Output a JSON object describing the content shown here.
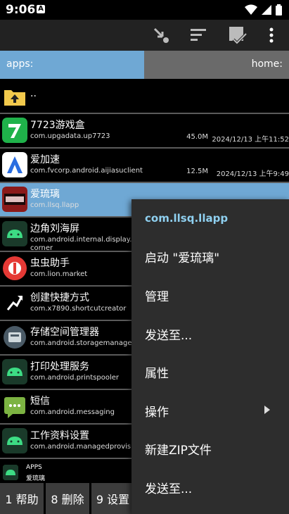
{
  "status": {
    "time": "9:06",
    "notification": "A"
  },
  "path": {
    "left": "apps:",
    "right": "home:"
  },
  "parent_label": "..",
  "apps": [
    {
      "name": "7723游戏盒",
      "package": "com.upgadata.up7723",
      "size": "45.0M",
      "date": "2024/12/13 上午11:52",
      "icon": "7723-app-icon",
      "color": "#1fb24a"
    },
    {
      "name": "爱加速",
      "package": "com.fvcorp.android.aijiasuclient",
      "size": "12.5M",
      "date": "2024/12/13 上午9:49",
      "icon": "aijiasu-app-icon",
      "color": "#ffffff"
    },
    {
      "name": "爱琉璃",
      "package": "com.llsq.llapp",
      "size": "",
      "date": "",
      "icon": "ailiuli-app-icon",
      "color": "#8b1a1a",
      "selected": true
    },
    {
      "name": "边角刘海屏",
      "package": "com.android.internal.display.cutout.emulation.corner",
      "package_lines": [
        "com.android.internal.display.cut",
        "corner"
      ],
      "size": "",
      "date": "",
      "icon": "android-app-icon",
      "color": "#3ddc84"
    },
    {
      "name": "虫虫助手",
      "package": "com.lion.market",
      "size": "",
      "date": "",
      "icon": "chongchong-app-icon",
      "color": "#e53935"
    },
    {
      "name": "创建快捷方式",
      "package": "com.x7890.shortcutcreator",
      "size": "",
      "date": "",
      "icon": "shortcut-app-icon",
      "color": "#000000"
    },
    {
      "name": "存储空间管理器",
      "package": "com.android.storagemanager",
      "size": "",
      "date": "",
      "icon": "storage-app-icon",
      "color": "#555555"
    },
    {
      "name": "打印处理服务",
      "package": "com.android.printspooler",
      "size": "",
      "date": "",
      "icon": "android-app-icon",
      "color": "#3ddc84"
    },
    {
      "name": "短信",
      "package": "com.android.messaging",
      "size": "",
      "date": "",
      "icon": "messaging-app-icon",
      "color": "#7cb342"
    },
    {
      "name": "工作资料设置",
      "package": "com.android.managedprovisioning",
      "size": "",
      "date": "",
      "icon": "android-app-icon",
      "color": "#3ddc84"
    }
  ],
  "info": {
    "line1": "APPS",
    "line2": "爱琉璃"
  },
  "function_keys": [
    "1 帮助",
    "8 删除",
    "9 设置"
  ],
  "menu": {
    "title": "com.llsq.llapp",
    "items": [
      "启动 \"爱琉璃\"",
      "管理",
      "发送至...",
      "属性",
      "操作",
      "新建ZIP文件",
      "发送至..."
    ]
  },
  "colors": {
    "selection": "#6fa8d4",
    "menu_bg": "#2d2d2d",
    "menu_title": "#8fd0f0"
  }
}
